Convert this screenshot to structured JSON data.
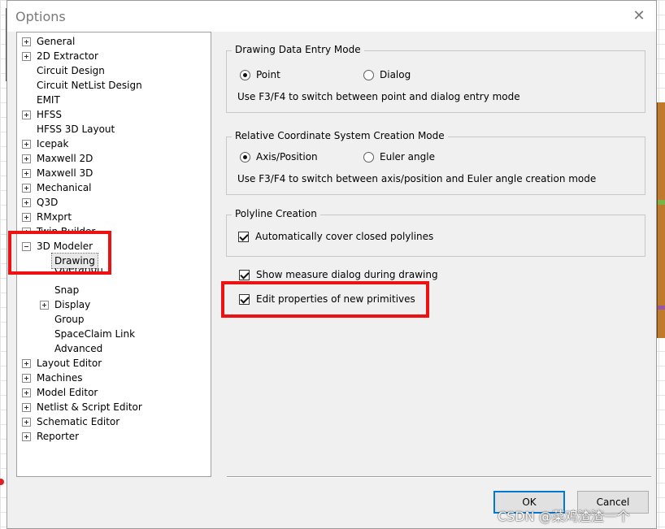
{
  "dialog": {
    "title": "Options",
    "close_glyph": "✕"
  },
  "tree": {
    "items": [
      {
        "label": "General",
        "expander": "plus"
      },
      {
        "label": "2D Extractor",
        "expander": "plus"
      },
      {
        "label": "Circuit Design",
        "expander": "none"
      },
      {
        "label": "Circuit NetList Design",
        "expander": "none"
      },
      {
        "label": "EMIT",
        "expander": "none"
      },
      {
        "label": "HFSS",
        "expander": "plus"
      },
      {
        "label": "HFSS 3D Layout",
        "expander": "none"
      },
      {
        "label": "Icepak",
        "expander": "plus"
      },
      {
        "label": "Maxwell 2D",
        "expander": "plus"
      },
      {
        "label": "Maxwell 3D",
        "expander": "plus"
      },
      {
        "label": "Mechanical",
        "expander": "plus"
      },
      {
        "label": "Q3D",
        "expander": "plus"
      },
      {
        "label": "RMxprt",
        "expander": "plus"
      },
      {
        "label": "Twin Builder",
        "expander": "plus"
      },
      {
        "label": "3D Modeler",
        "expander": "minus"
      },
      {
        "label": "Drawing",
        "expander": "none",
        "selected": true
      },
      {
        "label": "Operation",
        "expander": "none"
      },
      {
        "label": "Snap",
        "expander": "none"
      },
      {
        "label": "Display",
        "expander": "plus"
      },
      {
        "label": "Group",
        "expander": "none"
      },
      {
        "label": "SpaceClaim Link",
        "expander": "none"
      },
      {
        "label": "Advanced",
        "expander": "none"
      },
      {
        "label": "Layout Editor",
        "expander": "plus"
      },
      {
        "label": "Machines",
        "expander": "plus"
      },
      {
        "label": "Model Editor",
        "expander": "plus"
      },
      {
        "label": "Netlist & Script Editor",
        "expander": "plus"
      },
      {
        "label": "Schematic Editor",
        "expander": "plus"
      },
      {
        "label": "Reporter",
        "expander": "plus"
      }
    ]
  },
  "drawing_entry": {
    "title": "Drawing Data Entry Mode",
    "option_point": "Point",
    "option_dialog": "Dialog",
    "selected": "Point",
    "hint": "Use F3/F4 to switch between point and dialog entry mode"
  },
  "relative_cs": {
    "title": "Relative Coordinate System Creation Mode",
    "option_axis": "Axis/Position",
    "option_euler": "Euler angle",
    "selected": "Axis/Position",
    "hint": "Use F3/F4 to switch between axis/position and Euler angle creation mode"
  },
  "polyline": {
    "title": "Polyline Creation",
    "auto_cover_label": "Automatically cover closed polylines",
    "auto_cover_checked": true
  },
  "options": {
    "show_measure_label": "Show measure dialog during drawing",
    "show_measure_checked": true,
    "edit_props_label": "Edit properties of new primitives",
    "edit_props_checked": true
  },
  "buttons": {
    "ok": "OK",
    "cancel": "Cancel"
  },
  "watermark": "CSDN @菜鸡渣渣一个",
  "colors": {
    "annotation": "#ee1111",
    "dialog_bg": "#f0f0f0"
  }
}
